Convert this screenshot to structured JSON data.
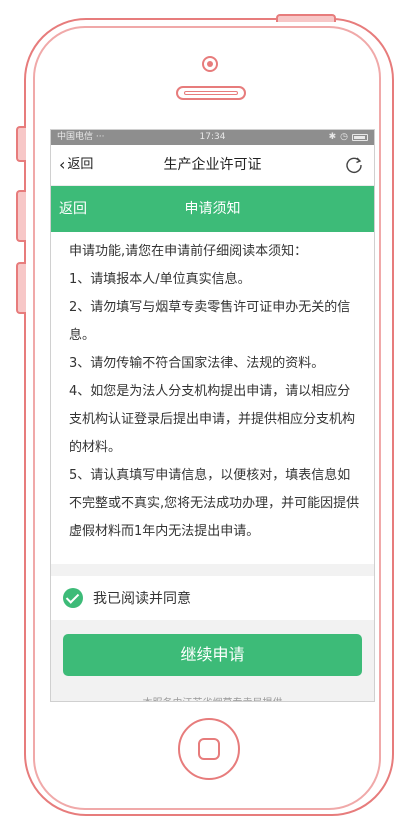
{
  "status_bar": {
    "carrier": "中国电信 ···",
    "time": "17:34"
  },
  "nav": {
    "back_label": "返回",
    "title": "生产企业许可证"
  },
  "header": {
    "back_label": "返回",
    "title": "申请须知"
  },
  "notice": [
    "申请功能,请您在申请前仔细阅读本须知：",
    "1、请填报本人/单位真实信息。",
    "2、请勿填写与烟草专卖零售许可证申办无关的信息。",
    "3、请勿传输不符合国家法律、法规的资料。",
    "4、如您是为法人分支机构提出申请，请以相应分支机构认证登录后提出申请，并提供相应分支机构的材料。",
    "5、请认真填写申请信息，以便核对，填表信息如不完整或不真实,您将无法成功办理，并可能因提供虚假材料而1年内无法提出申请。"
  ],
  "agree_label": "我已阅读并同意",
  "continue_label": "继续申请",
  "footer": "本服务由江苏省烟草专卖局提供",
  "colors": {
    "accent": "#3dbb78",
    "frame": "#e77c7c"
  },
  "icons": {
    "refresh": "refresh-icon",
    "check": "check-circle-icon",
    "back": "chevron-left-icon"
  }
}
